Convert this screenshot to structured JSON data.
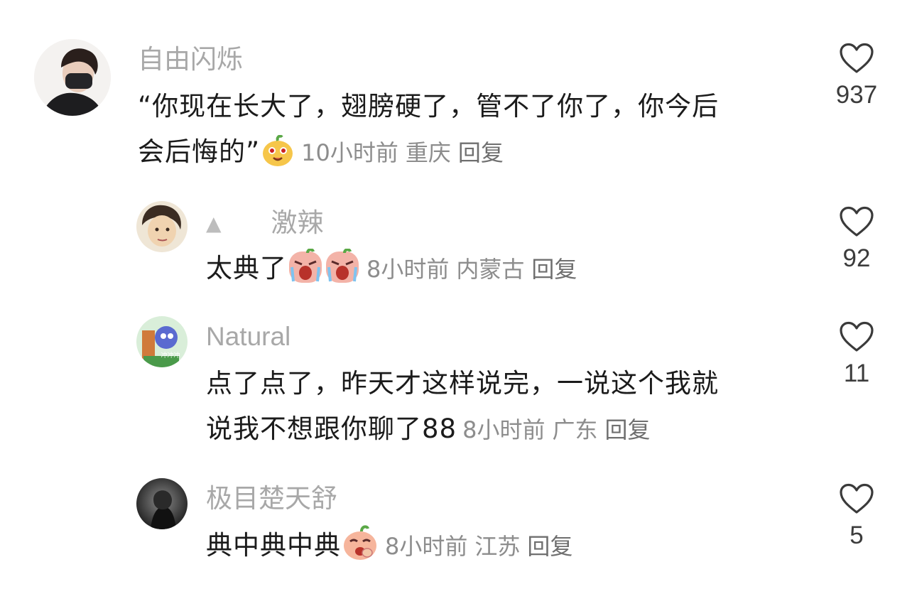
{
  "comments": [
    {
      "username": "自由闪烁",
      "text_line1": "“你现在长大了，翅膀硬了，管不了你了，你今后",
      "text_line2": "会后悔的”",
      "time": "10小时前",
      "location": "重庆",
      "reply_label": "回复",
      "likes": "937",
      "emoji": "smiley-peach-emoji"
    },
    {
      "username": "激辣",
      "text": "太典了",
      "time": "8小时前",
      "location": "内蒙古",
      "reply_label": "回复",
      "likes": "92",
      "emoji": "crying-peach-emoji"
    },
    {
      "username": "Natural",
      "text_line1": "点了点了，昨天才这样说完，一说这个我就",
      "text_line2": "说我不想跟你聊了88",
      "time": "8小时前",
      "location": "广东",
      "reply_label": "回复",
      "likes": "11",
      "avatar_text": "冲冲冲"
    },
    {
      "username": "极目楚天舒",
      "text": "典中典中典",
      "time": "8小时前",
      "location": "江苏",
      "reply_label": "回复",
      "likes": "5",
      "emoji": "laughing-peach-emoji"
    }
  ],
  "icons": {
    "like": "heart-outline-icon",
    "author_marker": "triangle-icon"
  },
  "colors": {
    "text": "#1b1b1b",
    "meta": "#8d8d8d",
    "name": "#a8a8a8",
    "heart": "#3a3a3a"
  }
}
